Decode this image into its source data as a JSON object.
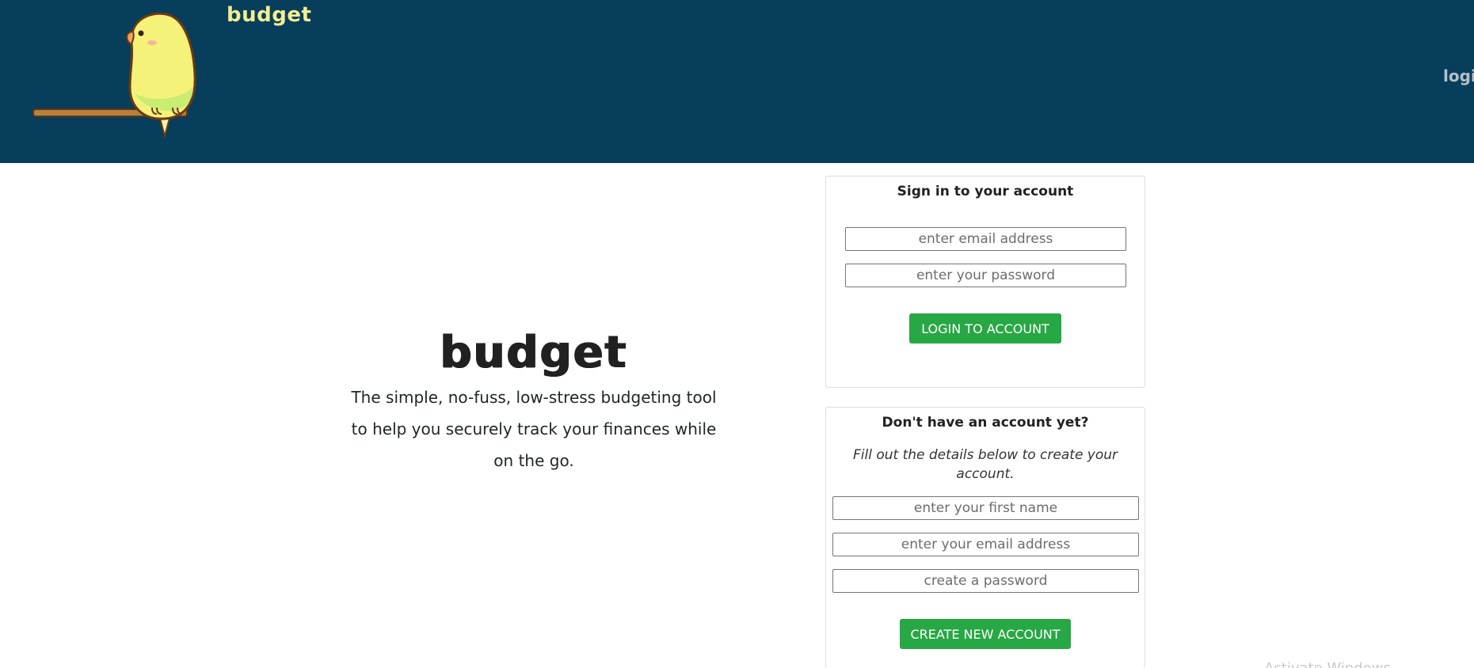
{
  "header": {
    "brand": "budget",
    "nav_login": "login",
    "logo_icon": "parakeet-logo-icon",
    "background_color": "#073e5c",
    "brand_color": "#f4ee91"
  },
  "hero": {
    "title": "budget",
    "tagline": "The simple, no-fuss, low-stress budgeting tool to help you securely track your finances while on the go."
  },
  "login_card": {
    "title": "Sign in to your account",
    "email_placeholder": "enter email address",
    "password_placeholder": "enter your password",
    "submit_label": "LOGIN TO ACCOUNT"
  },
  "signup_card": {
    "title": "Don't have an account yet?",
    "subtitle": "Fill out the details below to create your account.",
    "first_name_placeholder": "enter your first name",
    "email_placeholder": "enter your email address",
    "password_placeholder": "create a password",
    "submit_label": "CREATE NEW ACCOUNT"
  },
  "colors": {
    "button": "#28a745",
    "card_border": "#dddddd"
  },
  "watermark": {
    "text": "Activate Windows"
  }
}
